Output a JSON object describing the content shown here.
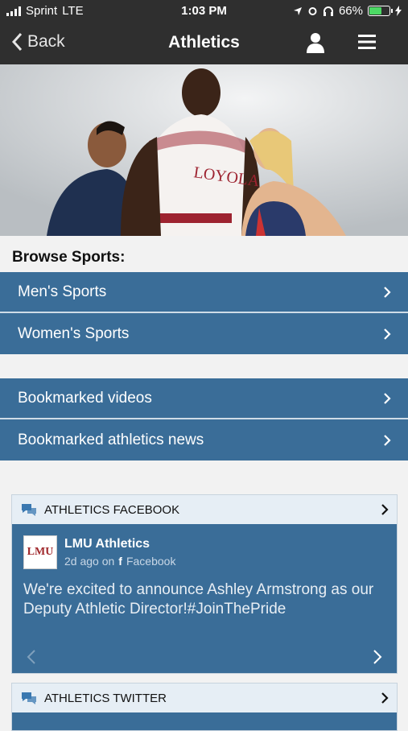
{
  "status_bar": {
    "carrier": "Sprint",
    "network": "LTE",
    "time": "1:03 PM",
    "battery": "66%",
    "battery_level": 0.66
  },
  "nav": {
    "back_label": "Back",
    "title": "Athletics"
  },
  "browse": {
    "label": "Browse Sports:",
    "items": [
      {
        "label": "Men's Sports"
      },
      {
        "label": "Women's Sports"
      }
    ]
  },
  "bookmarks": {
    "items": [
      {
        "label": "Bookmarked videos"
      },
      {
        "label": "Bookmarked athletics news"
      }
    ]
  },
  "facebook_card": {
    "header": "ATHLETICS FACEBOOK",
    "logo_text": "LMU",
    "author": "LMU Athletics",
    "time_ago": "2d ago on",
    "source": "Facebook",
    "text": "We're excited to announce Ashley Armstrong as our Deputy Athletic Director!#JoinThePride"
  },
  "twitter_card": {
    "header": "ATHLETICS TWITTER"
  },
  "colors": {
    "nav_bg": "#2f2f2f",
    "accent_blue": "#3a6d98",
    "card_header_bg": "#e6eef5",
    "logo_red": "#a0282c"
  }
}
